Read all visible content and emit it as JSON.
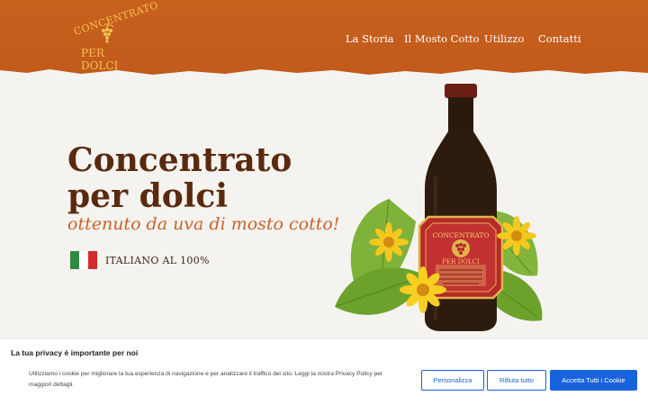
{
  "header": {
    "logo_line1": "CONCENTRATO",
    "logo_line2": "PER DOLCI",
    "nav": [
      "La Storia",
      "Il Mosto Cotto",
      "Utilizzo",
      "Contatti"
    ]
  },
  "hero": {
    "title_line1": "Concentrato",
    "title_line2": "per dolci",
    "subtitle": "ottenuto da uva di mosto cotto!",
    "badge_label": "ITALIANO AL 100%"
  },
  "product": {
    "label_line1": "CONCENTRATO",
    "label_line2": "PER DOLCI"
  },
  "cookie": {
    "title": "La tua privacy è importante per noi",
    "text": "Utilizziamo i cookie per migliorare la tua esperienza di navigazione e per analizzare il traffico del sito. Leggi la nostra Privacy Policy per maggiori dettagli.",
    "customize": "Personalizza",
    "reject": "Rifiuta tutto",
    "accept": "Accetta Tutti i Cookie"
  },
  "colors": {
    "header": "#c8601e",
    "title": "#5a2a0e",
    "subtitle": "#c7632a",
    "accent_blue": "#1863dc"
  },
  "icons": {
    "logo": "grape-cluster-icon",
    "flag": "italy-flag-icon"
  }
}
